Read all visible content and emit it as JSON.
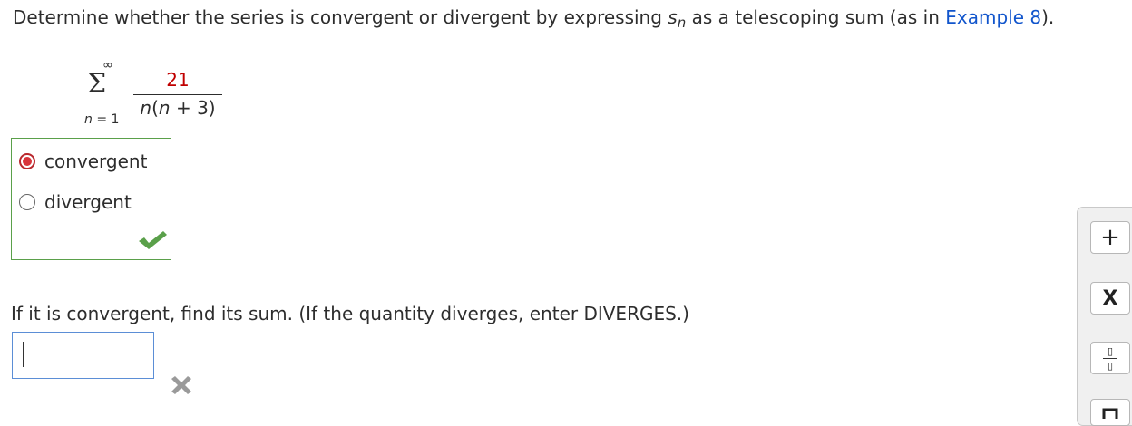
{
  "question1": {
    "text_before": "Determine whether the series is convergent or divergent by expressing ",
    "var": "s",
    "sub": "n",
    "text_after": " as a telescoping sum (as in ",
    "link": "Example 8",
    "text_end": ")."
  },
  "series": {
    "upper": "∞",
    "sigma": "Σ",
    "lower_var": "n",
    "lower_rest": " = 1",
    "numerator": "21",
    "den_n1": "n",
    "den_mid": "(",
    "den_n2": "n",
    "den_end": " + 3)"
  },
  "options": [
    {
      "label": "convergent",
      "selected": true
    },
    {
      "label": "divergent",
      "selected": false
    }
  ],
  "question2": {
    "text": "If it is convergent, find its sum. (If the quantity diverges, enter DIVERGES.)"
  },
  "answer": {
    "value": ""
  },
  "colors": {
    "correct": "#5aa04a",
    "incorrect": "#9a9a9a",
    "radio_selected": "#d8343b",
    "link": "#1155cc"
  },
  "palette": {
    "plus": "+",
    "times": "X",
    "frac_top": "▯",
    "frac_bottom": "▯"
  }
}
